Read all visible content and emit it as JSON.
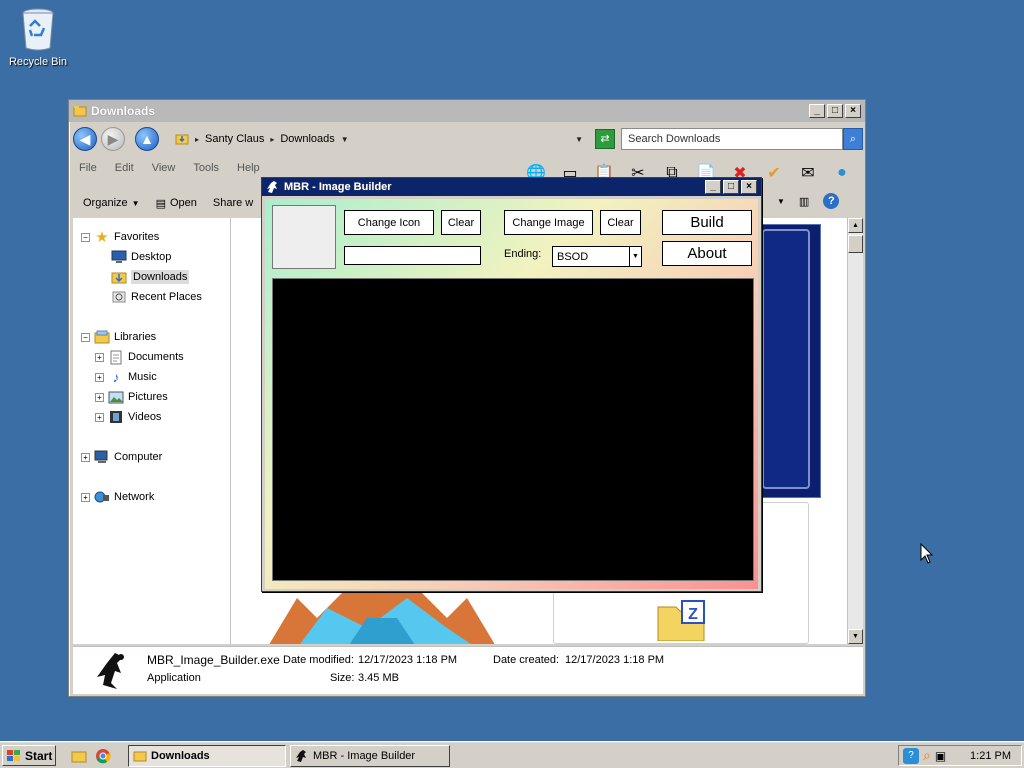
{
  "desktop": {
    "recycle_bin_label": "Recycle Bin"
  },
  "explorer": {
    "title": "Downloads",
    "breadcrumbs": [
      "Santy Claus",
      "Downloads"
    ],
    "search_placeholder": "Search Downloads",
    "menu": [
      "File",
      "Edit",
      "View",
      "Tools",
      "Help"
    ],
    "commands": {
      "organize": "Organize",
      "open": "Open",
      "share": "Share w"
    },
    "tree": {
      "favorites": "Favorites",
      "desktop": "Desktop",
      "downloads": "Downloads",
      "recent": "Recent Places",
      "libraries": "Libraries",
      "documents": "Documents",
      "music": "Music",
      "pictures": "Pictures",
      "videos": "Videos",
      "computer": "Computer",
      "network": "Network"
    },
    "details": {
      "file_name": "MBR_Image_Builder.exe",
      "file_type": "Application",
      "date_modified_label": "Date modified:",
      "date_modified": "12/17/2023 1:18 PM",
      "date_created_label": "Date created:",
      "date_created": "12/17/2023 1:18 PM",
      "size_label": "Size:",
      "size": "3.45 MB"
    }
  },
  "mbr": {
    "title": "MBR - Image Builder",
    "change_icon": "Change Icon",
    "clear": "Clear",
    "change_image": "Change Image",
    "build": "Build",
    "about": "About",
    "ending_label": "Ending:",
    "ending_value": "BSOD",
    "name_value": ""
  },
  "taskbar": {
    "start": "Start",
    "tasks": [
      "Downloads",
      "MBR - Image Builder"
    ],
    "clock": "1:21 PM"
  },
  "colors": {
    "desktop": "#3a6ea5",
    "mbr_titlebar": "#0b246a"
  }
}
